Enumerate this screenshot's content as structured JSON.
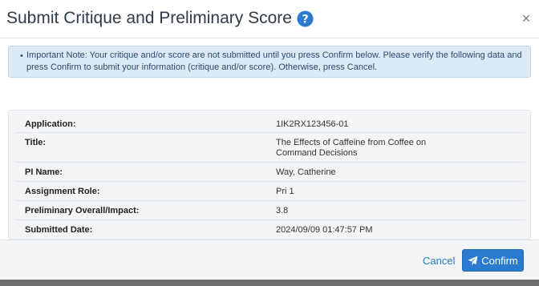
{
  "header": {
    "title": "Submit Critique and Preliminary Score",
    "help_icon": "question-circle-icon",
    "close_icon": "close-icon",
    "close_label": "×"
  },
  "alert": {
    "bullet": "•",
    "text": "Important Note: Your critique and/or score are not submitted until you press Confirm below. Please verify the following data and press Confirm to submit your information (critique and/or score). Otherwise, press Cancel."
  },
  "details": [
    {
      "label": "Application:",
      "value": "1IK2RX123456-01"
    },
    {
      "label": "Title:",
      "value": "The Effects of Caffeine from Coffee on Command Decisions"
    },
    {
      "label": "PI Name:",
      "value": "Way, Catherine"
    },
    {
      "label": "Assignment Role:",
      "value": "Pri 1"
    },
    {
      "label": "Preliminary Overall/Impact:",
      "value": "3.8"
    },
    {
      "label": "Submitted Date:",
      "value": "2024/09/09 01:47:57 PM"
    }
  ],
  "footer": {
    "cancel_label": "Cancel",
    "confirm_label": "Confirm",
    "confirm_icon": "send-icon"
  },
  "colors": {
    "title": "#2f3b4a",
    "help_icon": "#2a7bd0",
    "alert_bg": "#dce9f6",
    "primary": "#2a7bd0",
    "link": "#2b78c5"
  }
}
